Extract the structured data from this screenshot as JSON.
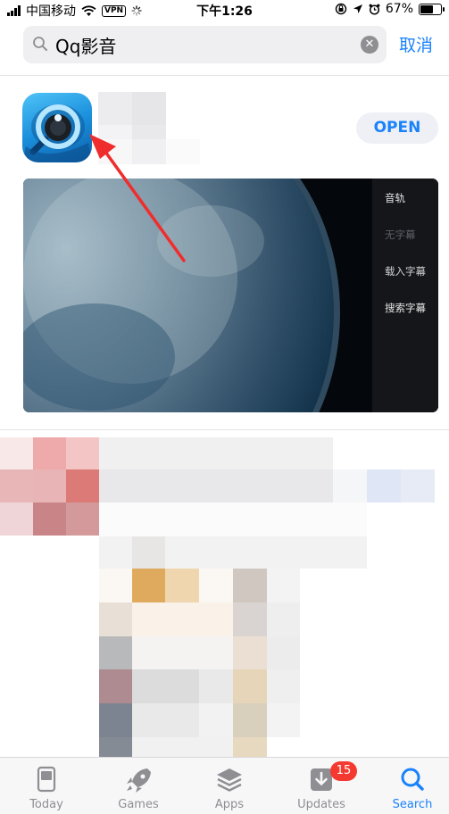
{
  "status_bar": {
    "carrier": "中国移动",
    "vpn": "VPN",
    "time": "下午1:26",
    "battery": "67%",
    "battery_level": 0.67
  },
  "search": {
    "query": "Qq影音",
    "cancel_label": "取消"
  },
  "result": {
    "action_label": "OPEN",
    "player_menu": [
      "音轨",
      "无字幕",
      "载入字幕",
      "搜索字幕"
    ]
  },
  "tab_bar": {
    "tabs": [
      {
        "label": "Today",
        "icon": "today-icon"
      },
      {
        "label": "Games",
        "icon": "rocket-icon"
      },
      {
        "label": "Apps",
        "icon": "layers-icon"
      },
      {
        "label": "Updates",
        "icon": "download-icon"
      },
      {
        "label": "Search",
        "icon": "search-icon"
      }
    ],
    "active": "Search",
    "updates_badge": "15"
  },
  "colors": {
    "accent": "#1a82fb",
    "badge": "#f43a30",
    "arrow": "#f02d2d"
  }
}
